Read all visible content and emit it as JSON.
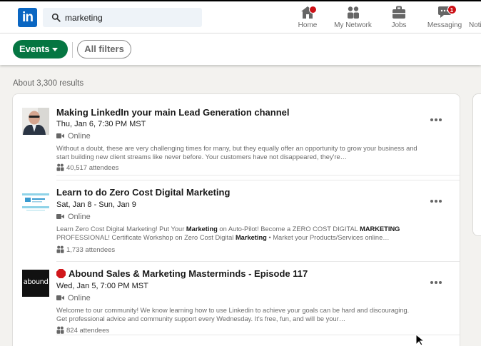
{
  "search": {
    "value": "marketing"
  },
  "logo_text": "in",
  "nav": [
    {
      "label": "Home",
      "icon": "home-icon"
    },
    {
      "label": "My Network",
      "icon": "people-icon"
    },
    {
      "label": "Jobs",
      "icon": "briefcase-icon"
    },
    {
      "label": "Messaging",
      "icon": "chat-icon",
      "badge": "1"
    },
    {
      "label": "Noti",
      "icon": "bell-icon"
    }
  ],
  "filters": {
    "events_label": "Events",
    "all_filters_label": "All filters"
  },
  "results_count": "About 3,300 results",
  "colors": {
    "brand": "#0a66c2",
    "green": "#057642",
    "badge": "#cc1016"
  },
  "events": [
    {
      "title": "Making LinkedIn your main Lead Generation channel",
      "date": "Thu, Jan 6, 7:30 PM MST",
      "online": "Online",
      "description": "Without a doubt, these are very challenging times for many, but they equally offer an opportunity to grow your business and start building new client streams like never before. Your customers have not disappeared, they're…",
      "attendees": "40,517 attendees"
    },
    {
      "title": "Learn to do Zero Cost Digital Marketing",
      "date": "Sat, Jan 8 - Sun, Jan 9",
      "online": "Online",
      "description_parts": [
        "Learn Zero Cost Digital Marketing! Put Your ",
        "Marketing",
        " on Auto-Pilot! Become a ZERO COST DIGITAL ",
        "MARKETING",
        " PROFESSIONAL! Certificate Workshop on Zero Cost Digital ",
        "Marketing",
        " • Market your Products/Services online…"
      ],
      "attendees": "1,733 attendees"
    },
    {
      "title": "Abound Sales & Marketing Masterminds - Episode 117",
      "date": "Wed, Jan 5, 7:00 PM MST",
      "online": "Online",
      "description": "Welcome to our community! We know learning how to use Linkedin to achieve your goals can be hard and discouraging. Get professional advice and community support every Wednesday. It's free, fun, and will be your…",
      "attendees": "824 attendees",
      "logo_text": "abound"
    }
  ]
}
